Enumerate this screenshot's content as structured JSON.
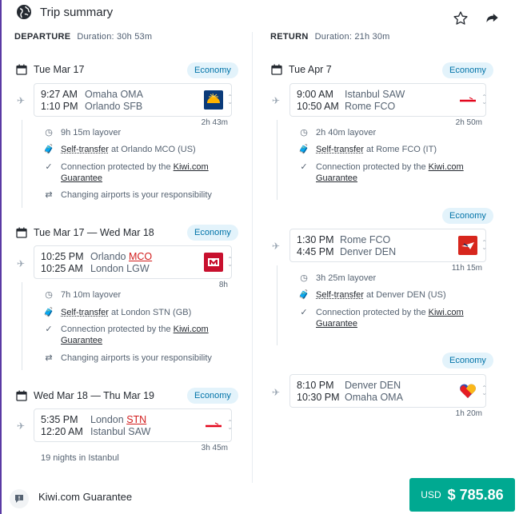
{
  "header": {
    "title": "Trip summary"
  },
  "departure": {
    "label": "DEPARTURE",
    "duration": "Duration: 30h 53m",
    "legs": [
      {
        "date": "Tue Mar 17",
        "cabin": "Economy",
        "dep_time": "9:27 AM",
        "dep_place": "Omaha OMA",
        "arr_time": "1:10 PM",
        "arr_place": "Orlando SFB",
        "duration": "2h 43m"
      },
      {
        "date": "Tue Mar 17 — Wed Mar 18",
        "cabin": "Economy",
        "dep_time": "10:25 PM",
        "dep_city": "Orlando",
        "dep_code": "MCO",
        "arr_time": "10:25 AM",
        "arr_place": "London LGW",
        "duration": "8h"
      },
      {
        "date": "Wed Mar 18 — Thu Mar 19",
        "cabin": "Economy",
        "dep_time": "5:35 PM",
        "dep_city": "London",
        "dep_code": "STN",
        "arr_time": "12:20 AM",
        "arr_place": "Istanbul SAW",
        "duration": "3h 45m"
      }
    ],
    "layovers": [
      {
        "time": "9h 15m layover",
        "transfer_link": "Self-transfer",
        "transfer_rest": " at Orlando MCO (US)",
        "protected_text": "Connection protected by the ",
        "protected_link1": "Kiwi.com",
        "protected_link2": "Guarantee",
        "airports": "Changing airports is your responsibility"
      },
      {
        "time": "7h 10m layover",
        "transfer_link": "Self-transfer",
        "transfer_rest": " at London STN (GB)",
        "protected_text": "Connection protected by the ",
        "protected_link1": "Kiwi.com",
        "protected_link2": "Guarantee",
        "airports": "Changing airports is your responsibility"
      }
    ],
    "nights": "19 nights in Istanbul"
  },
  "return": {
    "label": "RETURN",
    "duration": "Duration: 21h 30m",
    "date": "Tue Apr 7",
    "legs": [
      {
        "cabin": "Economy",
        "dep_time": "9:00 AM",
        "dep_place": "Istanbul SAW",
        "arr_time": "10:50 AM",
        "arr_place": "Rome FCO",
        "duration": "2h 50m"
      },
      {
        "cabin": "Economy",
        "dep_time": "1:30 PM",
        "dep_place": "Rome FCO",
        "arr_time": "4:45 PM",
        "arr_place": "Denver DEN",
        "duration": "11h 15m"
      },
      {
        "cabin": "Economy",
        "dep_time": "8:10 PM",
        "dep_place": "Denver DEN",
        "arr_time": "10:30 PM",
        "arr_place": "Omaha OMA",
        "duration": "1h 20m"
      }
    ],
    "layovers": [
      {
        "time": "2h 40m layover",
        "transfer_link": "Self-transfer",
        "transfer_rest": " at Rome FCO (IT)",
        "protected_text": "Connection protected by the ",
        "protected_link1": "Kiwi.com",
        "protected_link2": "Guarantee"
      },
      {
        "time": "3h 25m layover",
        "transfer_link": "Self-transfer",
        "transfer_rest": " at Denver DEN (US)",
        "protected_text": "Connection protected by the ",
        "protected_link1": "Kiwi.com",
        "protected_link2": "Guarantee"
      }
    ]
  },
  "footer": {
    "guarantee": "Kiwi.com Guarantee",
    "currency": "USD",
    "price": "$ 785.86"
  },
  "colors": {
    "accent": "#00a991",
    "badge_bg": "#e3f3fb",
    "badge_text": "#0073a8",
    "alert_red": "#d21c1c"
  },
  "icons": {
    "header": [
      "globe-icon",
      "star-icon",
      "share-icon"
    ],
    "rows": [
      "calendar-icon",
      "plane-icon",
      "clock-icon",
      "self-transfer-icon",
      "check-icon",
      "swap-icon",
      "comment-icon"
    ]
  }
}
